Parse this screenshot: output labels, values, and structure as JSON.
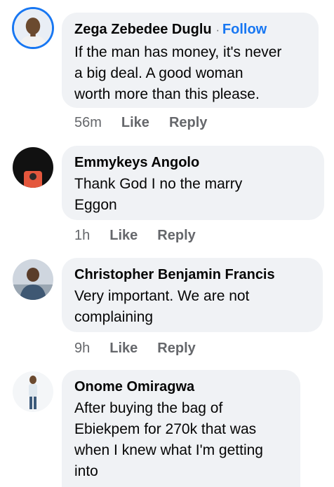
{
  "comments": [
    {
      "author": "Zega Zebedee Duglu",
      "follow_label": "Follow",
      "separator": "·",
      "text": "If the man has money, it's never\na big deal. A good woman\nworth more than this please.",
      "time": "56m",
      "like_label": "Like",
      "reply_label": "Reply"
    },
    {
      "author": "Emmykeys Angolo",
      "text": "Thank God I no the marry\nEggon",
      "time": "1h",
      "like_label": "Like",
      "reply_label": "Reply"
    },
    {
      "author": "Christopher Benjamin Francis",
      "text": "Very important. We are not\ncomplaining",
      "time": "9h",
      "like_label": "Like",
      "reply_label": "Reply"
    },
    {
      "author": "Onome Omiragwa",
      "text": "After buying the bag of\nEbiekpem for 270k that was\nwhen I knew what I'm getting\ninto"
    }
  ],
  "colors": {
    "bubble": "#f0f2f5",
    "link_blue": "#1877f2",
    "secondary_text": "#65676b"
  }
}
